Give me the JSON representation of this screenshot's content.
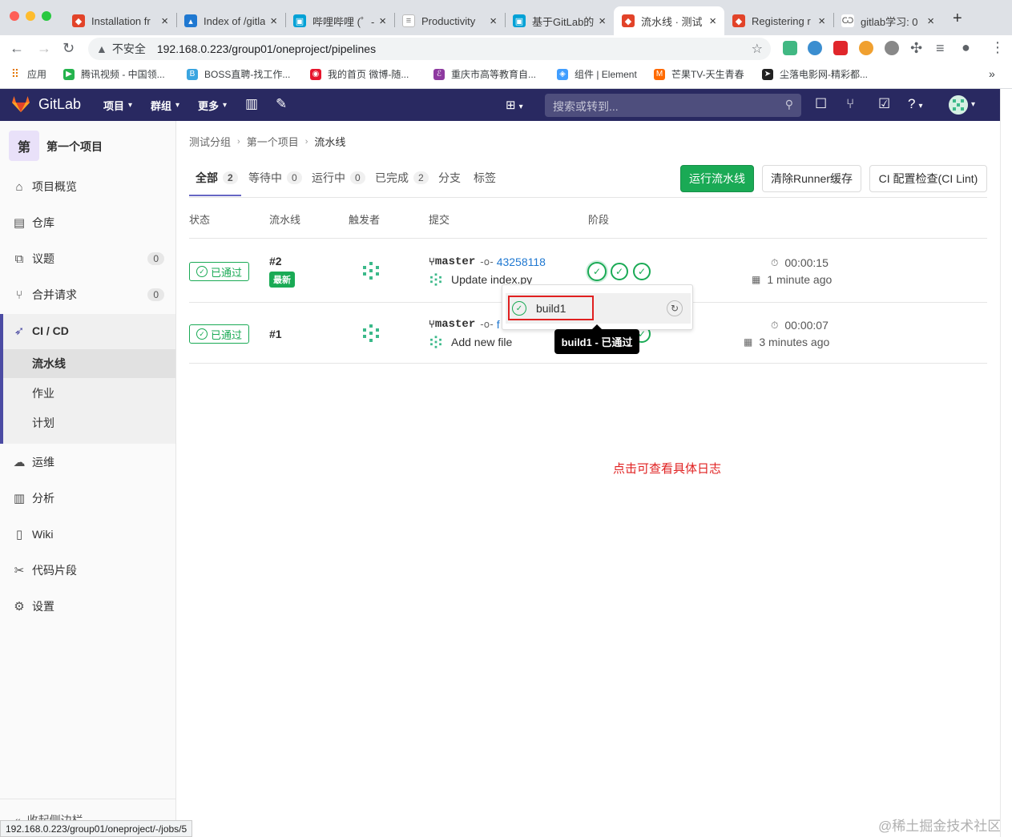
{
  "browser": {
    "tabs": [
      {
        "title": "Installation fr",
        "favicon_color": "#e24329"
      },
      {
        "title": "Index of /gitla",
        "favicon_color": "#1f78d1"
      },
      {
        "title": "哔哩哔哩 (゜-",
        "favicon_color": "#00a1d6"
      },
      {
        "title": "Productivity",
        "favicon_color": "#d0d0d0"
      },
      {
        "title": "基于GitLab的",
        "favicon_color": "#00a1d6"
      },
      {
        "title": "流水线 · 测试",
        "favicon_color": "#e24329"
      },
      {
        "title": "Registering r",
        "favicon_color": "#e24329"
      },
      {
        "title": "gitlab学习: 0",
        "favicon_color": "#555555"
      }
    ],
    "active_tab_index": 5,
    "security_label": "不安全",
    "url": "192.168.0.223/group01/oneproject/pipelines",
    "bookmarks": [
      {
        "label": "应用",
        "icon": "apps-grid-icon"
      },
      {
        "label": "腾讯视频 - 中国领...",
        "icon": "tencent-video-icon"
      },
      {
        "label": "BOSS直聘-找工作...",
        "icon": "boss-icon"
      },
      {
        "label": "我的首页 微博-随...",
        "icon": "weibo-icon"
      },
      {
        "label": "重庆市高等教育自...",
        "icon": "edu-icon"
      },
      {
        "label": "组件 | Element",
        "icon": "element-icon"
      },
      {
        "label": "芒果TV-天生青春",
        "icon": "mango-icon"
      },
      {
        "label": "尘落电影网-精彩都...",
        "icon": "movie-icon"
      }
    ],
    "status_url": "192.168.0.223/group01/oneproject/-/jobs/5"
  },
  "header": {
    "brand": "GitLab",
    "menus": [
      "项目",
      "群组",
      "更多"
    ],
    "search_placeholder": "搜索或转到..."
  },
  "sidebar": {
    "project_avatar": "第",
    "project_name": "第一个项目",
    "items": [
      {
        "label": "项目概览",
        "icon": "home-icon"
      },
      {
        "label": "仓库",
        "icon": "document-icon"
      },
      {
        "label": "议题",
        "icon": "issues-icon",
        "count": "0"
      },
      {
        "label": "合并请求",
        "icon": "merge-request-icon",
        "count": "0"
      },
      {
        "label": "CI / CD",
        "icon": "rocket-icon"
      },
      {
        "label": "运维",
        "icon": "cloud-icon"
      },
      {
        "label": "分析",
        "icon": "chart-icon"
      },
      {
        "label": "Wiki",
        "icon": "book-icon"
      },
      {
        "label": "代码片段",
        "icon": "scissors-icon"
      },
      {
        "label": "设置",
        "icon": "settings-icon"
      }
    ],
    "cicd_sub": [
      "流水线",
      "作业",
      "计划"
    ],
    "collapse_label": "收起侧边栏"
  },
  "breadcrumb": [
    "测试分组",
    "第一个项目",
    "流水线"
  ],
  "tabs": [
    {
      "label": "全部",
      "count": "2"
    },
    {
      "label": "等待中",
      "count": "0"
    },
    {
      "label": "运行中",
      "count": "0"
    },
    {
      "label": "已完成",
      "count": "2"
    },
    {
      "label": "分支"
    },
    {
      "label": "标签"
    }
  ],
  "buttons": {
    "run_pipeline": "运行流水线",
    "clear_cache": "清除Runner缓存",
    "ci_lint": "CI 配置检查(CI Lint)"
  },
  "table": {
    "headers": [
      "状态",
      "流水线",
      "触发者",
      "提交",
      "阶段"
    ],
    "rows": [
      {
        "status": "已通过",
        "id": "#2",
        "latest_badge": "最新",
        "branch": "master",
        "sha": "43258118",
        "message": "Update index.py",
        "duration": "00:00:15",
        "finished": "1 minute ago"
      },
      {
        "status": "已通过",
        "id": "#1",
        "branch": "master",
        "sha": "f",
        "message": "Add new file",
        "duration": "00:00:07",
        "finished": "3 minutes ago"
      }
    ]
  },
  "dropdown": {
    "job": "build1"
  },
  "tooltip": "build1 - 已通过",
  "annotation": "点击可查看具体日志",
  "watermark": "@稀土掘金技术社区",
  "colors": {
    "header": "#292961",
    "success": "#1aaa55",
    "accent": "#6666c4",
    "annotation": "#e02020"
  }
}
